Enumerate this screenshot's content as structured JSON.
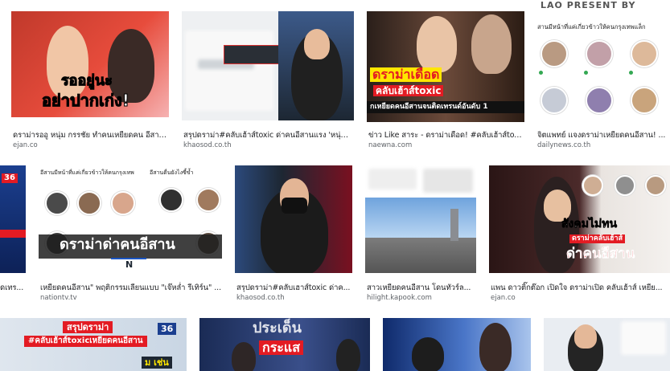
{
  "top_banner": "LAO PRESENT BY",
  "rows": [
    [
      {
        "caption": "ดราม่ารออู หนุ่ม กรรชัย ทำคนเหยียดคน อีสาน...",
        "source": "ejan.co",
        "overlay": [
          "รออยู่นะ",
          "อย่าปากเก่ง!"
        ]
      },
      {
        "caption": "สรุปดราม่า#คลับเฮ้าส์toxic ด่าคนอีสานแรง 'หนุ่ม ...",
        "source": "khaosod.co.th",
        "overlay": []
      },
      {
        "caption": "ข่าว Like สาระ - ดราม่าเดือด! #คลับเฮ้าส์toxi...",
        "source": "naewna.com",
        "overlay": [
          "ดราม่าเดือด",
          "คลับเฮ้าส์toxic",
          "กเหยียดคนอีสานจนติดเทรนด์อันดับ 1"
        ]
      },
      {
        "caption": "จิตแพทย์ แจงดราม่าเหยียดคนอีสาน! ...",
        "source": "dailynews.co.th",
        "overlay": [
          "สานมีหน้าที่แค่เกี่ยวข้าวให้คนกรุงเทพแล็ก"
        ]
      }
    ],
    [
      {
        "caption": "ดเทร...",
        "source": "",
        "overlay": [
          "36"
        ]
      },
      {
        "caption": "เหยียดคนอีสาน\" พฤติกรรมเลียนแบบ \"เจ๊หล่ำ รีเทิร์น\" ...",
        "source": "nationtv.tv",
        "overlay": [
          "ดราม่าด่าคนอีสาน",
          "อีสานมีหน้าที่แค่เกี่ยวข้าวให้คนกรุงเทพ",
          "อีสานดื่นยังไงซี้ข้ำ",
          "N"
        ]
      },
      {
        "caption": "สรุปดราม่า#คลับเฮาส์toxic ด่าค...",
        "source": "khaosod.co.th",
        "overlay": []
      },
      {
        "caption": "สาวเหยียดคนอีสาน โดนทัวร์ล...",
        "source": "hilight.kapook.com",
        "overlay": []
      },
      {
        "caption": "แพน ดาวติ๊กต๊อก เปิดใจ ดราม่าเปิด คลับเฮ้าส์ เหยีย...",
        "source": "ejan.co",
        "overlay": [
          "สังคมไม่ทน",
          "ดราม่าคลับเฮ้าส์",
          "ด่าคนอีสาน"
        ]
      }
    ],
    [
      {
        "caption": "",
        "source": "",
        "overlay": [
          "สรุปดราม่า",
          "#คลับเฮ้าส์toxicเหยียดคนอีสาน",
          "36",
          "ม เช่น"
        ]
      },
      {
        "caption": "",
        "source": "",
        "overlay": [
          "ประเด็น",
          "กระแส"
        ]
      },
      {
        "caption": "",
        "source": "",
        "overlay": []
      },
      {
        "caption": "",
        "source": "",
        "overlay": []
      }
    ]
  ],
  "colors": {
    "red": "#e31b23",
    "yellow": "#ffe600",
    "dark": "#1d2733",
    "green": "#34a853"
  }
}
